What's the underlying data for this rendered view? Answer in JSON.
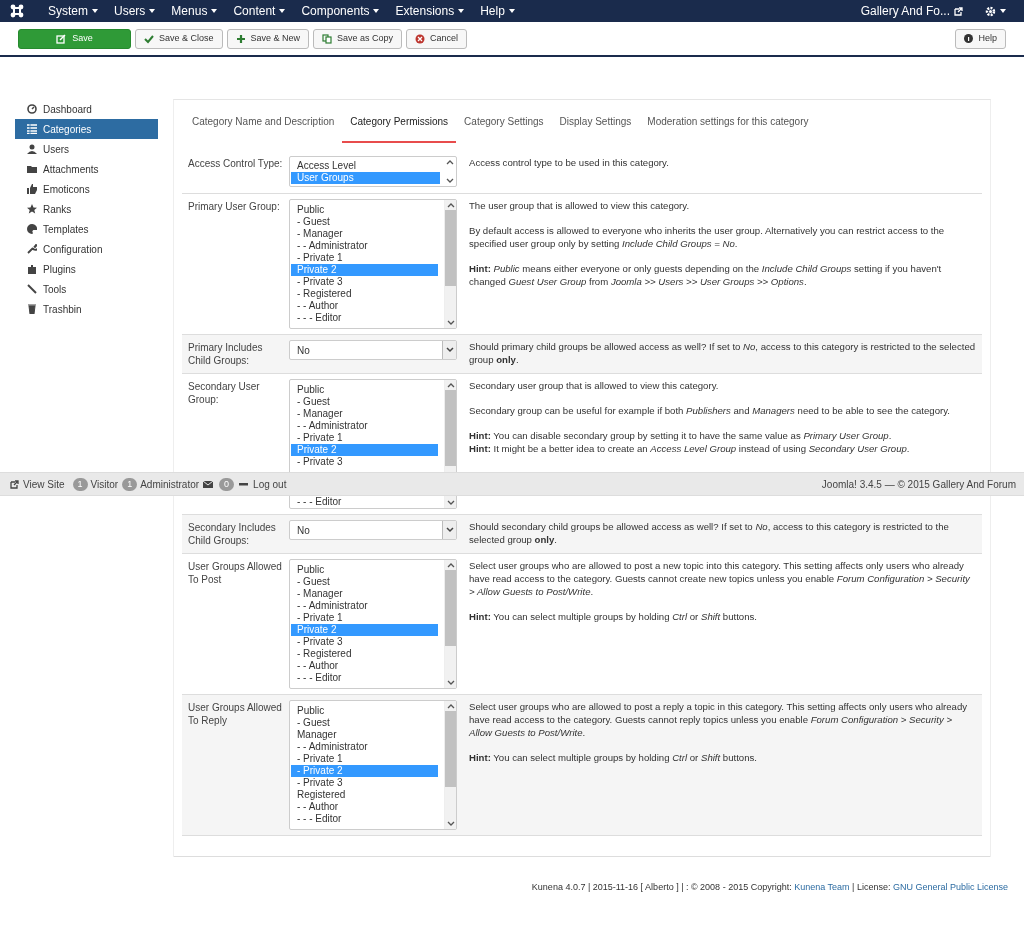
{
  "top_menu": [
    {
      "label": "System"
    },
    {
      "label": "Users"
    },
    {
      "label": "Menus"
    },
    {
      "label": "Content"
    },
    {
      "label": "Components"
    },
    {
      "label": "Extensions"
    },
    {
      "label": "Help"
    }
  ],
  "site_link": "Gallery And Fo...",
  "toolbar": [
    {
      "label": "Save",
      "kind": "save"
    },
    {
      "label": "Save & Close",
      "kind": "check"
    },
    {
      "label": "Save & New",
      "kind": "plus"
    },
    {
      "label": "Save as Copy",
      "kind": "copy"
    },
    {
      "label": "Cancel",
      "kind": "cancel"
    }
  ],
  "help_button": "Help",
  "sidebar": [
    {
      "label": "Dashboard",
      "kind": "dashboard",
      "selected": false
    },
    {
      "label": "Categories",
      "kind": "list",
      "selected": true
    },
    {
      "label": "Users",
      "kind": "user",
      "selected": false
    },
    {
      "label": "Attachments",
      "kind": "folder",
      "selected": false
    },
    {
      "label": "Emoticons",
      "kind": "thumb",
      "selected": false
    },
    {
      "label": "Ranks",
      "kind": "star",
      "selected": false
    },
    {
      "label": "Templates",
      "kind": "palette",
      "selected": false
    },
    {
      "label": "Configuration",
      "kind": "wrench",
      "selected": false
    },
    {
      "label": "Plugins",
      "kind": "puzzle",
      "selected": false
    },
    {
      "label": "Tools",
      "kind": "tool",
      "selected": false
    },
    {
      "label": "Trashbin",
      "kind": "trash",
      "selected": false
    }
  ],
  "tabs": [
    {
      "label": "Category Name and Description",
      "selected": false
    },
    {
      "label": "Category Permissions",
      "selected": true
    },
    {
      "label": "Category Settings",
      "selected": false
    },
    {
      "label": "Display Settings",
      "selected": false
    },
    {
      "label": "Moderation settings for this category",
      "selected": false
    }
  ],
  "fields": [
    {
      "label": "Access Control Type:",
      "kind": "select",
      "options": [
        {
          "label": "Access Level",
          "selected": false
        },
        {
          "label": "User Groups",
          "selected": true
        }
      ],
      "description": [
        "Access control type to be used in this category."
      ]
    },
    {
      "label": "Primary User Group:",
      "kind": "listbox",
      "options": [
        {
          "label": "Public",
          "selected": false
        },
        {
          "label": "- Guest",
          "selected": false
        },
        {
          "label": "- Manager",
          "selected": false
        },
        {
          "label": "- - Administrator",
          "selected": false
        },
        {
          "label": "- Private 1",
          "selected": false
        },
        {
          "label": "Private 2",
          "selected": true
        },
        {
          "label": "- Private 3",
          "selected": false
        },
        {
          "label": "- Registered",
          "selected": false
        },
        {
          "label": "- - Author",
          "selected": false
        },
        {
          "label": "- - - Editor",
          "selected": false
        }
      ],
      "description": [
        "The user group that is allowed to view this category.",
        "By default access is allowed to everyone who inherits the user group. Alternatively you can restrict access to the specified user group only by setting *Include Child Groups = No*.",
        "**Hint:** *Public* means either everyone or only guests depending on the *Include Child Groups* setting if you haven't changed *Guest User Group* from *Joomla >> Users >> User Groups >> Options*."
      ]
    },
    {
      "label": "Primary Includes Child Groups:",
      "kind": "dropdown",
      "value": "No",
      "description": [
        "Should primary child groups be allowed access as well? If set to *No*, access to this category is restricted to the selected group **only**."
      ]
    },
    {
      "label": "Secondary User Group:",
      "kind": "listbox",
      "options": [
        {
          "label": "Public",
          "selected": false
        },
        {
          "label": "- Guest",
          "selected": false
        },
        {
          "label": "- Manager",
          "selected": false
        },
        {
          "label": "- - Administrator",
          "selected": false
        },
        {
          "label": "- Private 1",
          "selected": false
        },
        {
          "label": "Private 2",
          "selected": true
        },
        {
          "label": "- Private 3",
          "selected": false
        }
      ],
      "options_below_status_bar": [
        {
          "label": "- - - Editor",
          "selected": false
        }
      ],
      "description": [
        "Secondary user group that is allowed to view this category.",
        "Secondary group can be useful for example if both *Publishers* and *Managers* need to be able to see the category.",
        [
          "**Hint:** You can disable secondary group by setting it to have the same value as *Primary User Group*.",
          "**Hint:** It might be a better idea to create an *Access Level Group* instead of using *Secondary User Group*."
        ]
      ]
    },
    {
      "label": "Secondary Includes Child Groups:",
      "kind": "dropdown",
      "value": "No",
      "description": [
        "Should secondary child groups be allowed access as well? If set to *No*, access to this category is restricted to the selected group **only**."
      ]
    },
    {
      "label": "User Groups Allowed To Post",
      "kind": "listbox",
      "options": [
        {
          "label": "Public",
          "selected": false
        },
        {
          "label": "- Guest",
          "selected": false
        },
        {
          "label": "- Manager",
          "selected": false
        },
        {
          "label": "- - Administrator",
          "selected": false
        },
        {
          "label": "- Private 1",
          "selected": false
        },
        {
          "label": "Private 2",
          "selected": true
        },
        {
          "label": "- Private 3",
          "selected": false
        },
        {
          "label": "- Registered",
          "selected": false
        },
        {
          "label": "- - Author",
          "selected": false
        },
        {
          "label": "- - - Editor",
          "selected": false
        }
      ],
      "description": [
        "Select user groups who are allowed to post a new topic into this category. This setting affects only users who already have read access to the category. Guests cannot create new topics unless you enable *Forum Configuration > Security > Allow Guests to Post/Write*.",
        "**Hint:** You can select multiple groups by holding *Ctrl* or *Shift* buttons."
      ]
    },
    {
      "label": "User Groups Allowed To Reply",
      "kind": "listbox",
      "options": [
        {
          "label": "Public",
          "selected": false
        },
        {
          "label": "- Guest",
          "selected": false
        },
        {
          "label": "Manager",
          "selected": false
        },
        {
          "label": "- - Administrator",
          "selected": false
        },
        {
          "label": "- Private 1",
          "selected": false
        },
        {
          "label": "- Private 2",
          "selected": true
        },
        {
          "label": "- Private 3",
          "selected": false
        },
        {
          "label": "Registered",
          "selected": false
        },
        {
          "label": "- - Author",
          "selected": false
        },
        {
          "label": "- - - Editor",
          "selected": false
        }
      ],
      "description": [
        "Select user groups who are allowed to post a reply a topic in this category. This setting affects only users who already have read access to the category. Guests cannot reply topics unless you enable *Forum Configuration > Security > Allow Guests to Post/Write*.",
        "**Hint:** You can select multiple groups by holding *Ctrl* or *Shift* buttons."
      ]
    }
  ],
  "status_bar": {
    "view_site": "View Site",
    "visitors": {
      "count": "1",
      "label": "Visitor"
    },
    "admins": {
      "count": "1",
      "label": "Administrator"
    },
    "messages": "0",
    "logout": "Log out",
    "version": "Joomla! 3.4.5 — © 2015 Gallery And Forum"
  },
  "footer": {
    "text": "Kunena 4.0.7 | 2015-11-16 [ Alberto ] | : © 2008 - 2015 Copyright: ",
    "team_link": "Kunena Team",
    "license_label": " | License: ",
    "license_link": "GNU General Public License"
  }
}
